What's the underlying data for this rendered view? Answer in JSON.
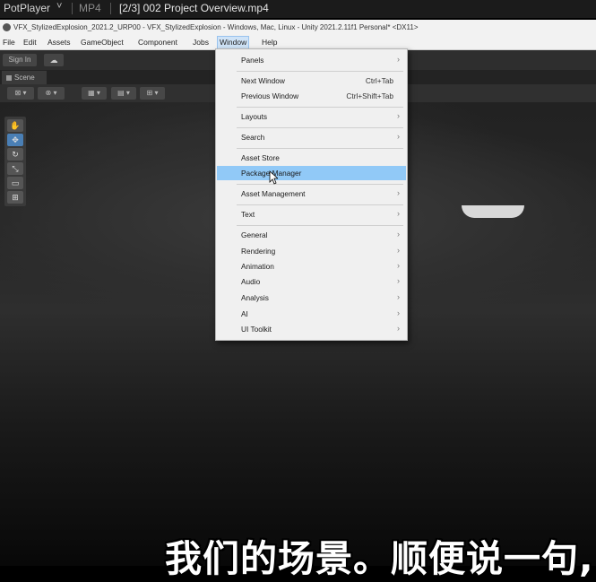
{
  "potplayer": {
    "app_name": "PotPlayer",
    "chevron": "˅",
    "format": "MP4",
    "file_title": "[2/3] 002 Project Overview.mp4"
  },
  "unity": {
    "window_title": "VFX_StylizedExplosion_2021.2_URP00 - VFX_StylizedExplosion - Windows, Mac, Linux - Unity 2021.2.11f1 Personal* <DX11>",
    "menu": [
      "File",
      "Edit",
      "Assets",
      "GameObject",
      "Component",
      "Jobs",
      "Window",
      "Help"
    ],
    "active_menu": "Window",
    "toolbar": {
      "sign_in": "Sign In",
      "cloud_icon": "cloud-icon"
    },
    "scene_tab": "Scene"
  },
  "window_menu": {
    "items": [
      {
        "label": "Panels",
        "submenu": true
      },
      {
        "label": "Next Window",
        "shortcut": "Ctrl+Tab"
      },
      {
        "label": "Previous Window",
        "shortcut": "Ctrl+Shift+Tab"
      },
      {
        "label": "Layouts",
        "submenu": true
      },
      {
        "label": "Search",
        "submenu": true
      },
      {
        "label": "Asset Store"
      },
      {
        "label": "Package Manager",
        "highlighted": true
      },
      {
        "label": "Asset Management",
        "submenu": true
      },
      {
        "label": "Text",
        "submenu": true
      },
      {
        "label": "General",
        "submenu": true
      },
      {
        "label": "Rendering",
        "submenu": true
      },
      {
        "label": "Animation",
        "submenu": true
      },
      {
        "label": "Audio",
        "submenu": true
      },
      {
        "label": "Analysis",
        "submenu": true
      },
      {
        "label": "AI",
        "submenu": true
      },
      {
        "label": "UI Toolkit",
        "submenu": true
      }
    ],
    "arrow": "›"
  },
  "subtitle": "我们的场景。顺便说一句,",
  "colors": {
    "highlight": "#91c9f7",
    "menu_bg": "#f0f0f0",
    "scene_bg": "#2a2a2a"
  }
}
